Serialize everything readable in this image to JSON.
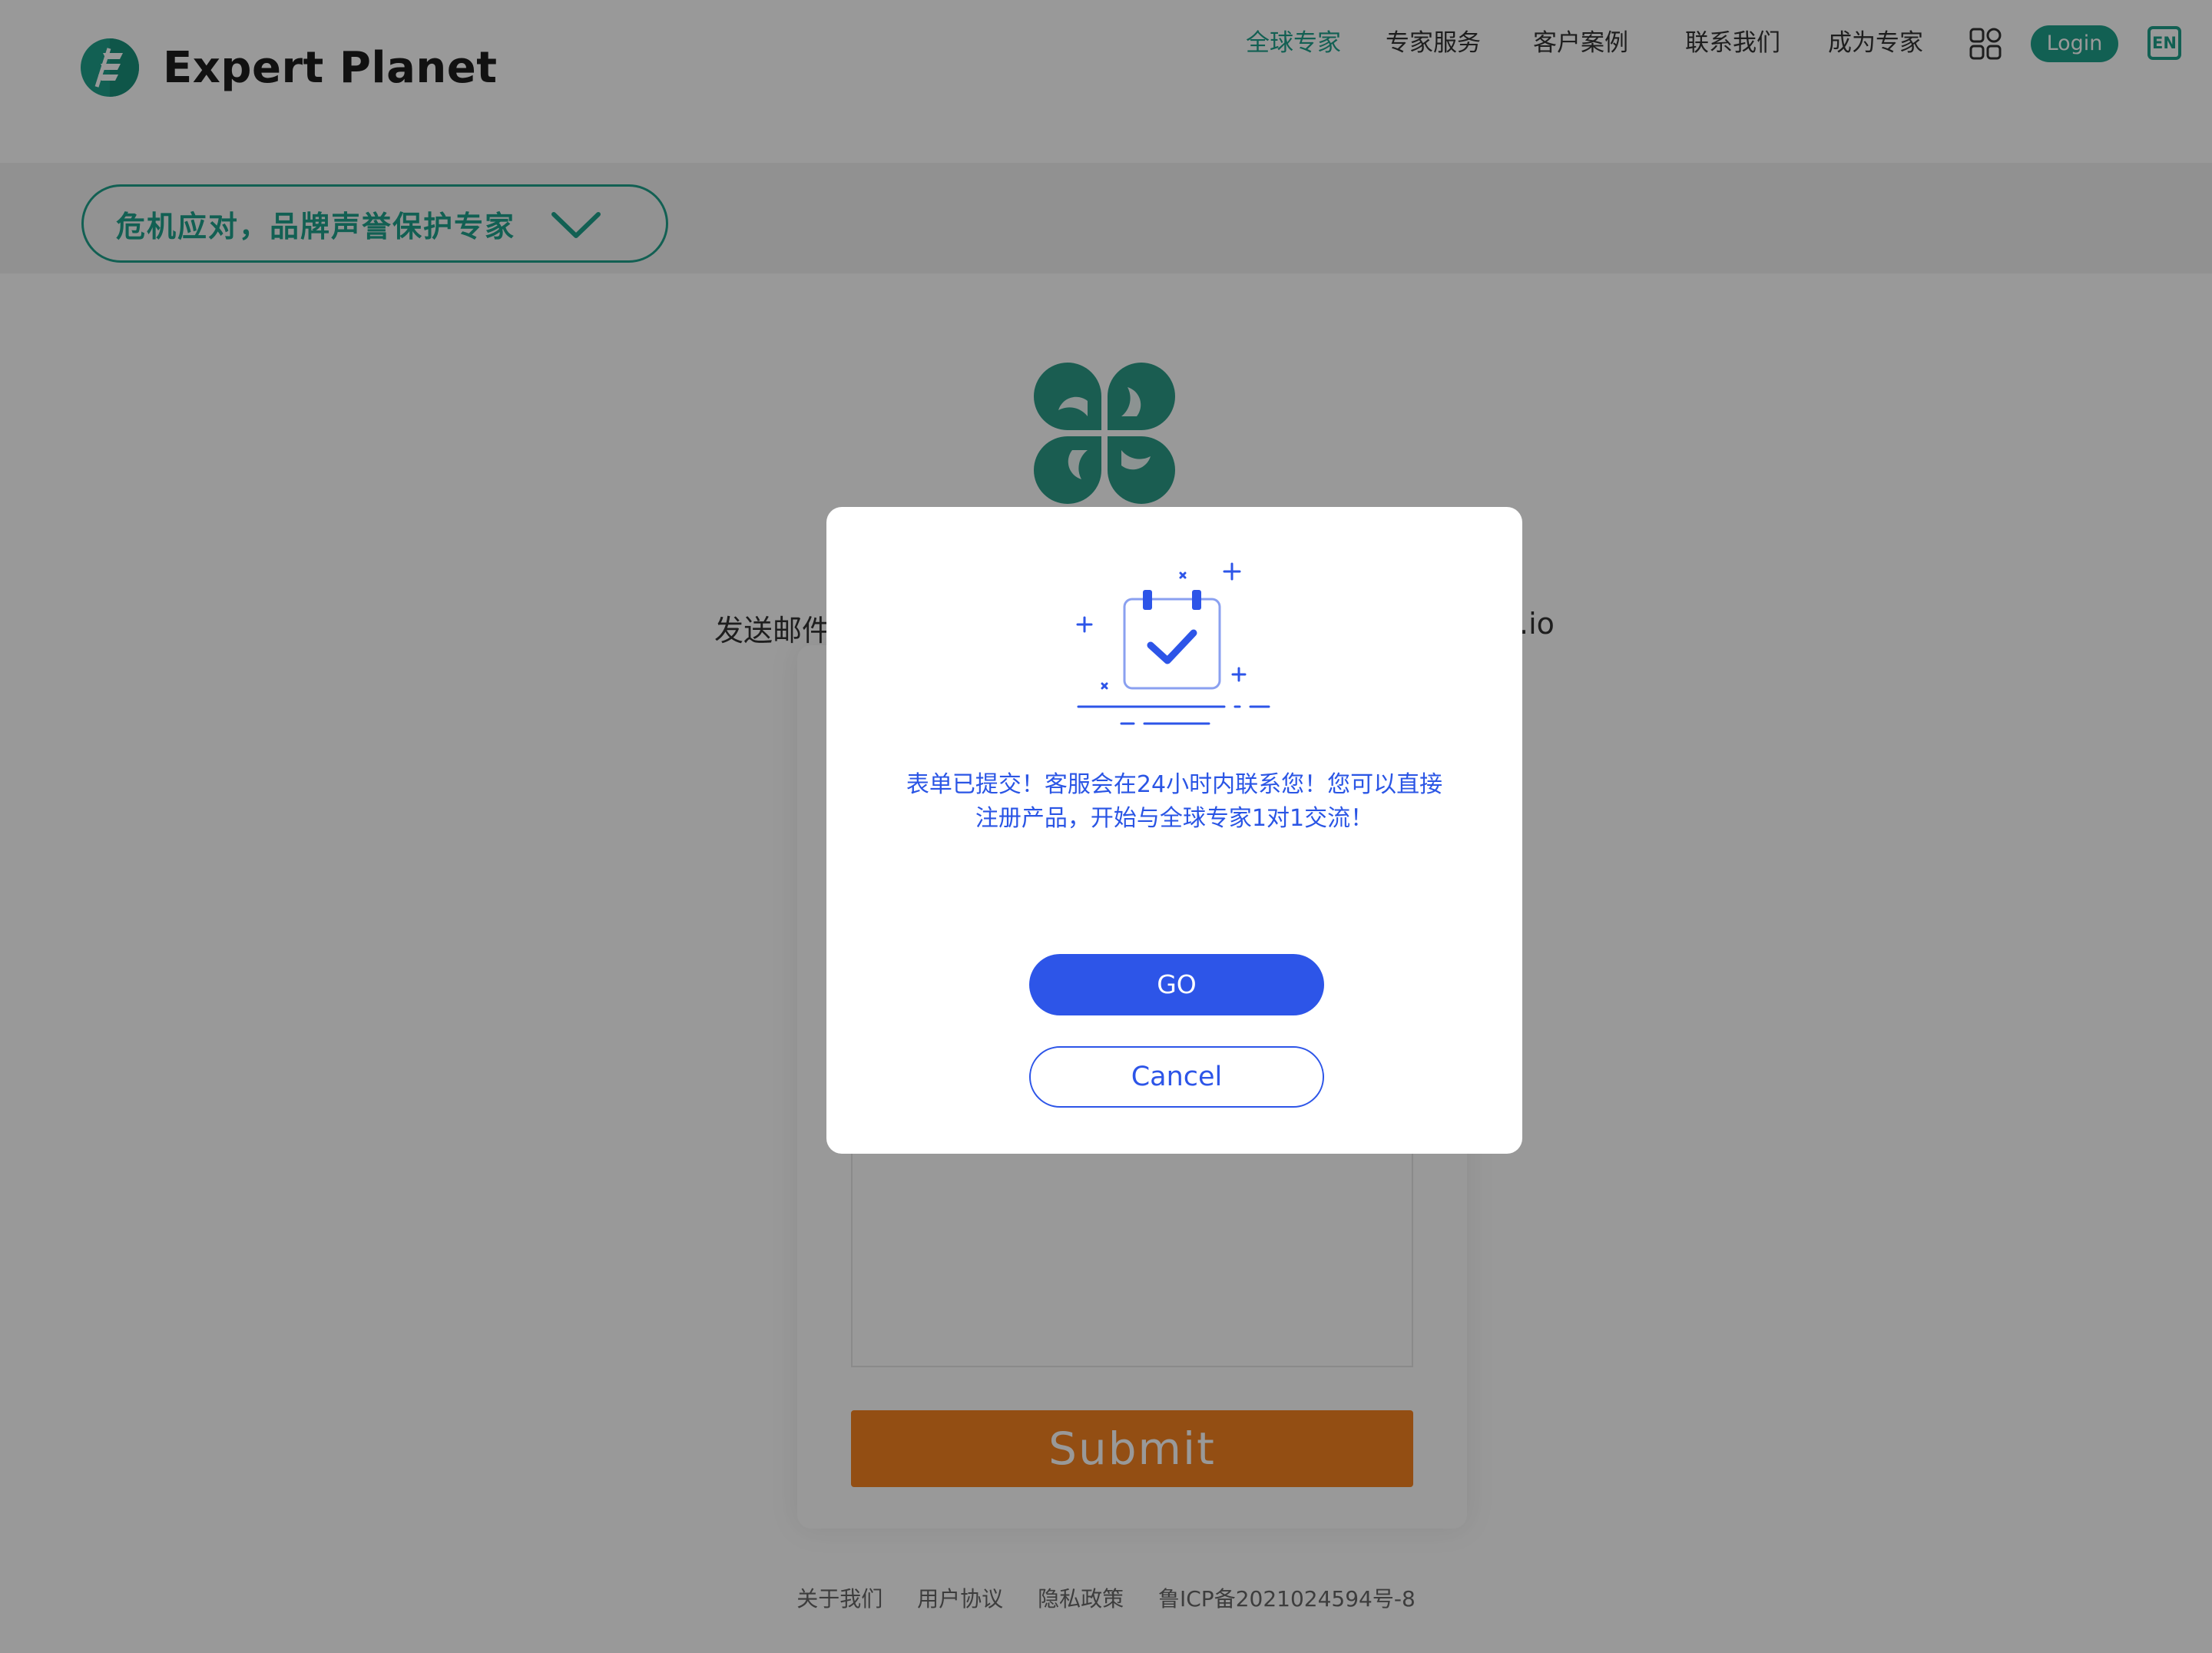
{
  "header": {
    "brand_name": "Expert Planet",
    "nav": [
      {
        "label": "全球专家",
        "active": true
      },
      {
        "label": "专家服务",
        "active": false
      },
      {
        "label": "客户案例",
        "active": false
      },
      {
        "label": "联系我们",
        "active": false
      },
      {
        "label": "成为专家",
        "active": false
      }
    ],
    "login_label": "Login",
    "language_label": "EN"
  },
  "topic_selector": {
    "label": "危机应对，品牌声誉保护专家",
    "icon": "chevron-down-icon"
  },
  "main": {
    "email_text_left": "发送邮件",
    "email_text_right": ".io",
    "submit_label": "Submit"
  },
  "footer": {
    "links": [
      "关于我们",
      "用户协议",
      "隐私政策"
    ],
    "icp": "鲁ICP备2021024594号-8"
  },
  "modal": {
    "illustration": "calendar-check-icon",
    "message": "表单已提交！客服会在24小时内联系您！您可以直接注册产品，开始与全球专家1对1交流！",
    "go_label": "GO",
    "cancel_label": "Cancel"
  },
  "colors": {
    "brand_green": "#1fa08a",
    "clover_green": "#2c9b88",
    "submit_orange": "#f58220",
    "modal_blue": "#2d55e8",
    "overlay": "rgba(0,0,0,0.40)"
  }
}
